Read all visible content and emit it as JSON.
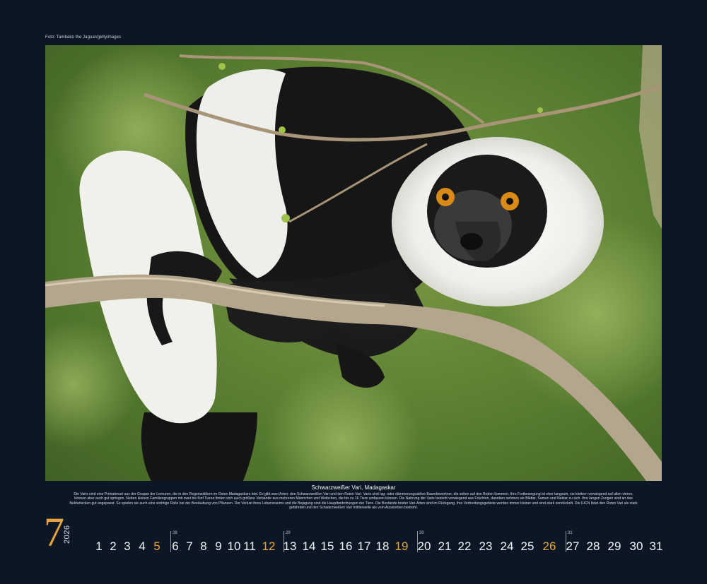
{
  "photo_credit": "Foto: Tambako the Jaguar/gettyimages",
  "caption": {
    "title": "Schwarzweißer Vari, Madagaskar",
    "body": "Die Varis sind eine Primatenart aus der Gruppe der Lemuren, die in den Regenwäldern im Osten Madagaskars lebt. Es gibt zwei Arten: den Schwarzweißen Vari und den Roten Vari. Varis sind tag- oder dämmerungsaktive Baumbewohner, die selten auf den Boden kommen. Ihre Fortbewegung ist eher langsam, sie klettern vorwiegend auf allen vieren, können aber auch gut springen. Neben kleinen Familiengruppen mit zwei bis fünf Tieren finden sich auch größere Verbände aus mehreren Männchen und Weibchen, die bis zu 16 Tiere umfassen können. Die Nahrung der Varis besteht vorwiegend aus Früchten, daneben nehmen sie Blätter, Samen und Nektar zu sich. Ihre langen Zungen sind an das Nektarlecken gut angepasst. So spielen sie auch eine wichtige Rolle bei der Bestäubung von Pflanzen. Der Verlust ihres Lebensraums und die Bejagung sind die Hauptbedrohungen der Tiere. Die Bestände beider Vari-Arten sind im Rückgang, ihre Verbreitungsgebiete werden immer kleiner und sind stark zerstückelt. Die IUCN listet den Roten Vari als stark gefährdet und den Schwarzweißen Vari mittlerweile als vom Aussterben bedroht."
  },
  "calendar": {
    "month": "7",
    "year": "2026",
    "days": [
      "1",
      "2",
      "3",
      "4",
      "5",
      "6",
      "7",
      "8",
      "9",
      "10",
      "11",
      "12",
      "13",
      "14",
      "15",
      "16",
      "17",
      "18",
      "19",
      "20",
      "21",
      "22",
      "23",
      "24",
      "25",
      "26",
      "27",
      "28",
      "29",
      "30",
      "31"
    ],
    "sundays": [
      "5",
      "12",
      "19",
      "26"
    ],
    "week_numbers": [
      "28",
      "29",
      "30",
      "31"
    ]
  },
  "colors": {
    "background": "#0b1724",
    "accent": "#e8a33c",
    "text": "#eef2f5"
  }
}
